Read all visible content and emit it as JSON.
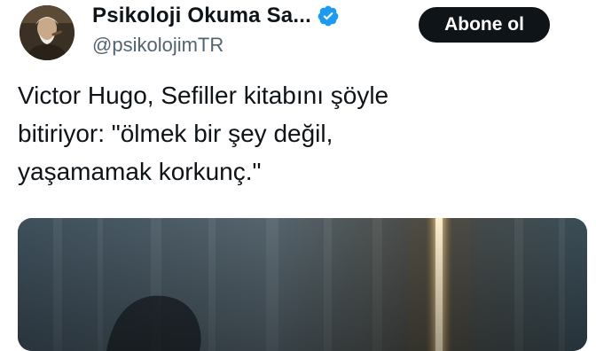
{
  "author": {
    "display_name": "Psikoloji Okuma Sa...",
    "handle": "@psikolojimTR",
    "verified": true,
    "avatar_icon": "profile-photo"
  },
  "follow_button": {
    "label": "Abone ol"
  },
  "tweet": {
    "lines": [
      "Victor Hugo, Sefiller kitabını şöyle",
      "bitiriyor: \"ölmek bir şey değil,",
      "yaşamamak korkunç.\""
    ]
  },
  "media": {
    "icon": "attached-photo"
  },
  "colors": {
    "text_primary": "#0f1419",
    "text_secondary": "#536471",
    "verified_blue": "#1d9bf0",
    "button_bg": "#0f1419"
  }
}
